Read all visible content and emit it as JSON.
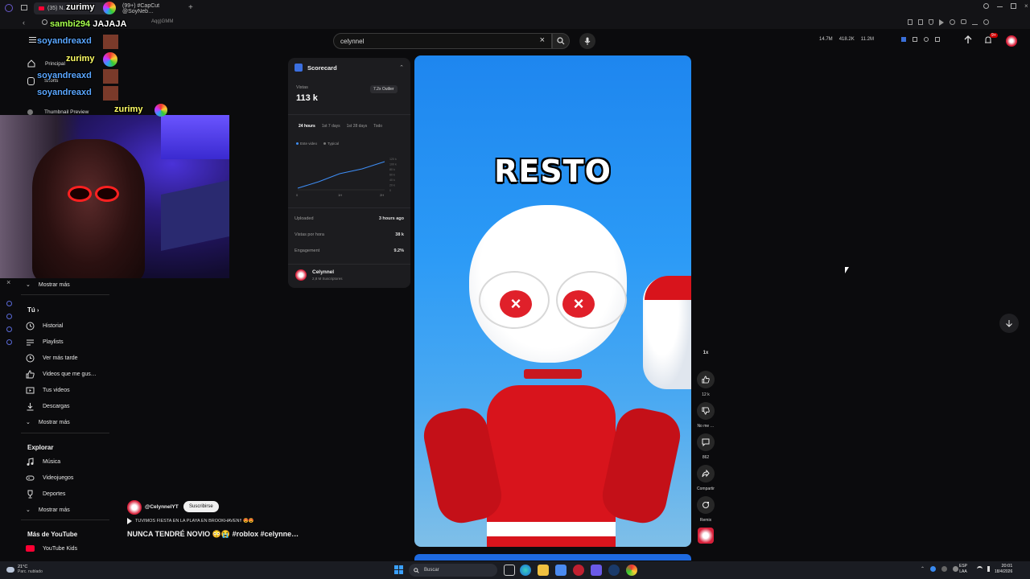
{
  "browser": {
    "tabs": [
      {
        "label": "(35) N…"
      },
      {
        "label": "(99+) #CapCut @SoyNeb…"
      }
    ],
    "address_fragment": "Aqg)GMM"
  },
  "youtube": {
    "search": {
      "value": "celynnel"
    },
    "header_stats": {
      "stat1": "14.7M",
      "stat2": "418.2K",
      "stat3": "11.2M"
    },
    "notification_count": "9+"
  },
  "sidebar_top": {
    "items": [
      "Principal",
      "Shorts",
      "Thumbnail Preview"
    ]
  },
  "sidebar": {
    "show_more_1": "Mostrar más",
    "you_heading": "Tú",
    "you_items": [
      {
        "label": "Historial",
        "icon": "history-icon"
      },
      {
        "label": "Playlists",
        "icon": "playlist-icon"
      },
      {
        "label": "Ver más tarde",
        "icon": "clock-icon"
      },
      {
        "label": "Videos que me gus…",
        "icon": "thumbs-up-icon"
      },
      {
        "label": "Tus videos",
        "icon": "video-icon"
      },
      {
        "label": "Descargas",
        "icon": "download-icon"
      }
    ],
    "show_more_2": "Mostrar más",
    "explore_heading": "Explorar",
    "explore_items": [
      {
        "label": "Música",
        "icon": "music-icon"
      },
      {
        "label": "Videojuegos",
        "icon": "gamepad-icon"
      },
      {
        "label": "Deportes",
        "icon": "trophy-icon"
      }
    ],
    "show_more_3": "Mostrar más",
    "more_heading": "Más de YouTube",
    "kids": "YouTube Kids"
  },
  "scorecard": {
    "title": "Scorecard",
    "views_label": "Vistas",
    "views_value": "113 k",
    "outlier": "7.2x Outlier",
    "tabs": [
      "24 hours",
      "1st 7 days",
      "1st 28 days",
      "Todo"
    ],
    "legend": {
      "this": "Este video",
      "typical": "Typical"
    },
    "x_ticks": [
      "0",
      "1H",
      "2H"
    ],
    "y_ticks": [
      "120 k",
      "100 k",
      "80 k",
      "60 k",
      "40 k",
      "20 k",
      "0"
    ],
    "uploaded_label": "Uploaded",
    "uploaded_value": "3 hours ago",
    "vph_label": "Vistas por hora",
    "vph_value": "38 k",
    "engagement_label": "Engagement",
    "engagement_value": "9.2%",
    "channel_name": "Celynnel",
    "channel_subs": "2,8 M Suscriptores"
  },
  "video": {
    "caption": "RESTO"
  },
  "actions": {
    "speed": "1x",
    "likes": "12 k",
    "dislike_label": "No me …",
    "comments": "862",
    "share": "Compartir",
    "remix": "Remix"
  },
  "channel_info": {
    "handle": "@CelynnelYT",
    "subscribe": "Suscribirse",
    "description": "TUVIMOS FIESTA EN LA PLAYA EN BROOKHAVEN!! 😍😍",
    "title": "NUNCA TENDRÉ NOVIO 😳😭 #roblox #celynne…"
  },
  "chat": [
    {
      "user": "zurimy",
      "msg": "",
      "color": "#ffffff"
    },
    {
      "user": "sambi294",
      "msg": "JAJAJA",
      "color": "#a6ff4d"
    },
    {
      "user": "soyandreaxd",
      "msg": "",
      "color": "#5aa6ff"
    },
    {
      "user": "zurimy",
      "msg": "",
      "color": "#ffff66"
    },
    {
      "user": "soyandreaxd",
      "msg": "",
      "color": "#5aa6ff"
    },
    {
      "user": "soyandreaxd",
      "msg": "",
      "color": "#5aa6ff"
    },
    {
      "user": "zurimy",
      "msg": "",
      "color": "#ffff66"
    }
  ],
  "taskbar": {
    "weather_temp": "21°C",
    "weather_desc": "Parc. nublado",
    "search": "Buscar",
    "lang1": "ESP",
    "lang2": "LAA",
    "time": "20:01",
    "date": "18/4/2026"
  },
  "colors": {
    "accent_red": "#ff0033",
    "video_blue": "#2b9af6",
    "chart_line": "#3e8ef7"
  }
}
